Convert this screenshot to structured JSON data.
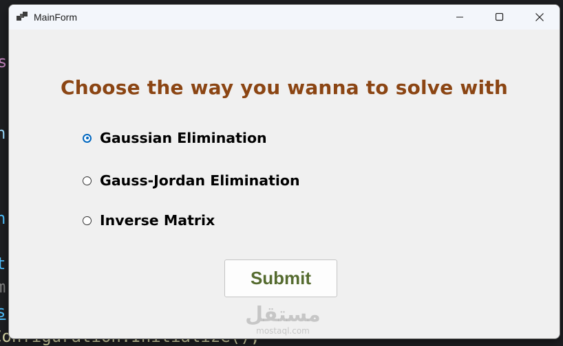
{
  "background_code": [
    {
      "text": "s",
      "color": "#c586c0"
    },
    {
      "text": "n",
      "color": "#9cdcfe"
    },
    {
      "text": "n",
      "color": "#4fc1ff"
    },
    {
      "text": "t",
      "color": "#4fc1ff"
    },
    {
      "text": "m",
      "color": "#808080"
    },
    {
      "text": "s",
      "color": "#4fc1ff"
    },
    {
      "text": "Configuration.Initialize();",
      "color": "#dcdcaa"
    }
  ],
  "window": {
    "title": "MainForm",
    "controls": {
      "minimize_icon": "minimize-icon",
      "maximize_icon": "maximize-icon",
      "close_icon": "close-icon"
    }
  },
  "form": {
    "heading": "Choose the way you wanna to solve with",
    "options": [
      {
        "label": "Gaussian Elimination",
        "checked": true
      },
      {
        "label": "Gauss-Jordan Elimination",
        "checked": false
      },
      {
        "label": "Inverse Matrix",
        "checked": false
      }
    ],
    "submit_label": "Submit"
  },
  "watermark": {
    "arabic": "مستقل",
    "latin": "mostaql.com"
  },
  "colors": {
    "heading": "#8b4513",
    "submit_text": "#556b2f",
    "radio_accent": "#0067c0",
    "window_bg": "#f0f0f0"
  }
}
